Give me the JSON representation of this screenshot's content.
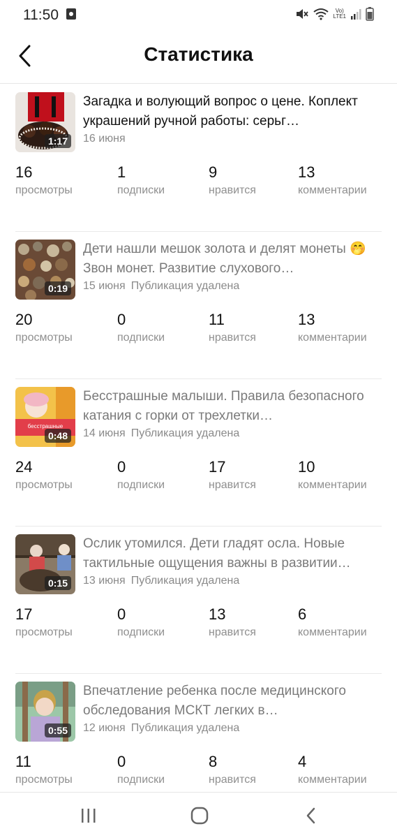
{
  "status_bar": {
    "time": "11:50",
    "net_line1": "Vo)",
    "net_line2": "LTE1"
  },
  "header": {
    "title": "Статистика"
  },
  "stat_labels": {
    "views": "просмотры",
    "subscriptions": "подписки",
    "likes": "нравится",
    "comments": "комментарии"
  },
  "videos": [
    {
      "title": "Загадка и волующий вопрос о цене. Коплект украшений ручной работы: серьг…",
      "date": "16 июня",
      "status": "",
      "duration": "1:17",
      "thumb_caption": "",
      "views": "16",
      "subscriptions": "1",
      "likes": "9",
      "comments": "13"
    },
    {
      "title": "Дети нашли мешок золота и делят монеты 🤭Звон монет. Развитие слухового…",
      "date": "15 июня",
      "status": "Публикация удалена",
      "duration": "0:19",
      "thumb_caption": "",
      "views": "20",
      "subscriptions": "0",
      "likes": "11",
      "comments": "13"
    },
    {
      "title": "Бесстрашные малыши. Правила безопасного катания с горки от трехлетки…",
      "date": "14 июня",
      "status": "Публикация удалена",
      "duration": "0:48",
      "thumb_caption": "бесстрашные",
      "views": "24",
      "subscriptions": "0",
      "likes": "17",
      "comments": "10"
    },
    {
      "title": "Ослик утомился. Дети гладят осла. Новые тактильные ощущения важны в развитии…",
      "date": "13 июня",
      "status": "Публикация удалена",
      "duration": "0:15",
      "thumb_caption": "",
      "views": "17",
      "subscriptions": "0",
      "likes": "13",
      "comments": "6"
    },
    {
      "title": "Впечатление ребенка после медицинского обследования МСКТ легких в…",
      "date": "12 июня",
      "status": "Публикация удалена",
      "duration": "0:55",
      "thumb_caption": "",
      "views": "11",
      "subscriptions": "0",
      "likes": "8",
      "comments": "4"
    }
  ]
}
